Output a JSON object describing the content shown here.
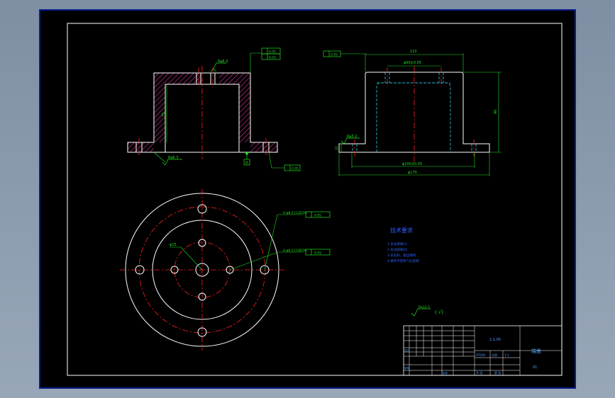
{
  "colors": {
    "background": "#000000",
    "viewport_border": "#0a1f8f",
    "outline": "#ffffff",
    "centerline": "#ff2020",
    "hatch": "#c0308a",
    "dimension": "#20e020",
    "hidden": "#30c8e0",
    "leader": "#20e020",
    "title_text": "#4aa0ff",
    "notes_text": "#3060ff"
  },
  "front_section": {
    "roughness_top": "Ra6.3",
    "roughness_bottom": "Ra6.3",
    "height_dim": "75",
    "tol_frame_top_1": "0.05",
    "tol_frame_top_2": "0.02",
    "datum_label": "B",
    "tol_frame_bottom": "0.05"
  },
  "side_view": {
    "tol_frame": "0.05",
    "top_width": "110",
    "bore_dim": "φ60±0.05",
    "height": "90",
    "flange_thk": "12",
    "roughness": "Ra3.2",
    "spigot_dim": "φ100±0.05",
    "outer_dim": "φ170"
  },
  "plan_view": {
    "center_hole_dim": "φ15",
    "callout_1": "4-φ8.5↧12EQS",
    "callout_1_frame": "0.05",
    "callout_2": "4-φ6.5↧10EQS",
    "callout_2_frame": "0.05"
  },
  "notes": {
    "heading": "技术要求",
    "lines": [
      "1.未注倒角C1",
      "2.未注圆角R2",
      "3.去毛刺，锐边倒钝",
      "4.铸件不得有气孔砂眼"
    ]
  },
  "roughness_general": {
    "symbol_value": "Ra12.5",
    "paren": "(  √)"
  },
  "title_block": {
    "ratio": "1:1.00",
    "part_name": "端盖",
    "material": "HT200",
    "drawing_no": "01",
    "scale_label": "比例",
    "scale_value": "1:1",
    "sheet_label": "共 张",
    "sheet_value": "第 张",
    "designer": "设计",
    "checker": "审核",
    "approver": "批准"
  }
}
